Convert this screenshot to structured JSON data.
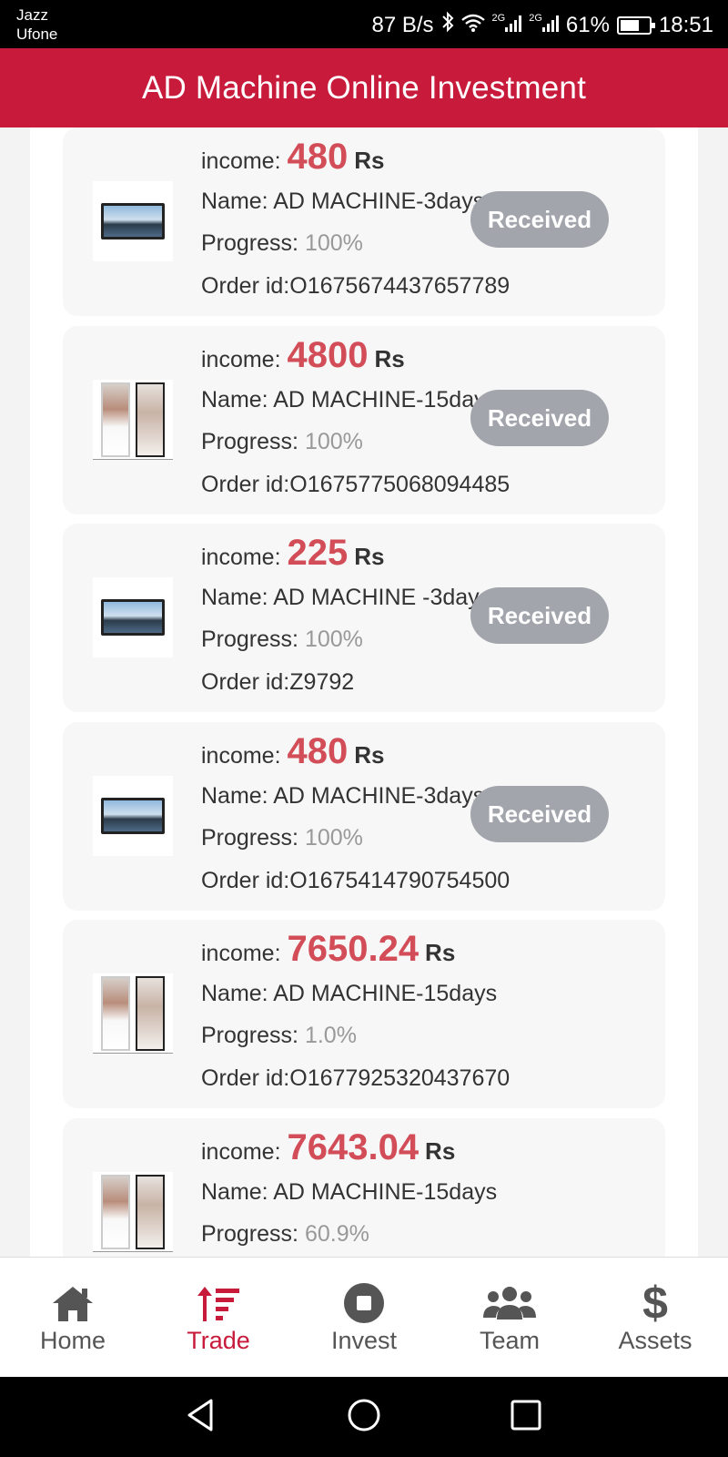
{
  "status_bar": {
    "carrier_1": "Jazz",
    "carrier_2": "Ufone",
    "speed": "87 B/s",
    "network_1": "2G",
    "network_2": "2G",
    "battery": "61%",
    "time": "18:51"
  },
  "header": {
    "title": "AD Machine Online Investment"
  },
  "labels": {
    "income": "income:",
    "currency": "Rs",
    "name": "Name:",
    "progress": "Progress:",
    "order_id": "Order id:"
  },
  "orders": [
    {
      "income": "480",
      "name": "AD MACHINE-3days",
      "progress": "100%",
      "order_id": "O1675674437657789",
      "status": "Received",
      "image": "tv-screen"
    },
    {
      "income": "4800",
      "name": "AD MACHINE-15days",
      "progress": "100%",
      "order_id": "O1675775068094485",
      "status": "Received",
      "image": "kiosk-display"
    },
    {
      "income": "225",
      "name": "AD MACHINE -3days",
      "progress": "100%",
      "order_id": "Z9792",
      "status": "Received",
      "image": "tv-screen"
    },
    {
      "income": "480",
      "name": "AD MACHINE-3days",
      "progress": "100%",
      "order_id": "O1675414790754500",
      "status": "Received",
      "image": "tv-screen"
    },
    {
      "income": "7650.24",
      "name": "AD MACHINE-15days",
      "progress": "1.0%",
      "order_id": "O1677925320437670",
      "status": "",
      "image": "kiosk-display"
    },
    {
      "income": "7643.04",
      "name": "AD MACHINE-15days",
      "progress": "60.9%",
      "order_id": "",
      "status": "",
      "image": "kiosk-display"
    }
  ],
  "bottom_nav": [
    {
      "label": "Home",
      "icon": "home-icon",
      "active": false
    },
    {
      "label": "Trade",
      "icon": "sort-amount-icon",
      "active": true
    },
    {
      "label": "Invest",
      "icon": "stop-circle-icon",
      "active": false
    },
    {
      "label": "Team",
      "icon": "users-icon",
      "active": false
    },
    {
      "label": "Assets",
      "icon": "dollar-icon",
      "active": false
    }
  ],
  "colors": {
    "brand": "#c81a3b",
    "income": "#d24d57",
    "received_badge": "#a2a5ab"
  }
}
